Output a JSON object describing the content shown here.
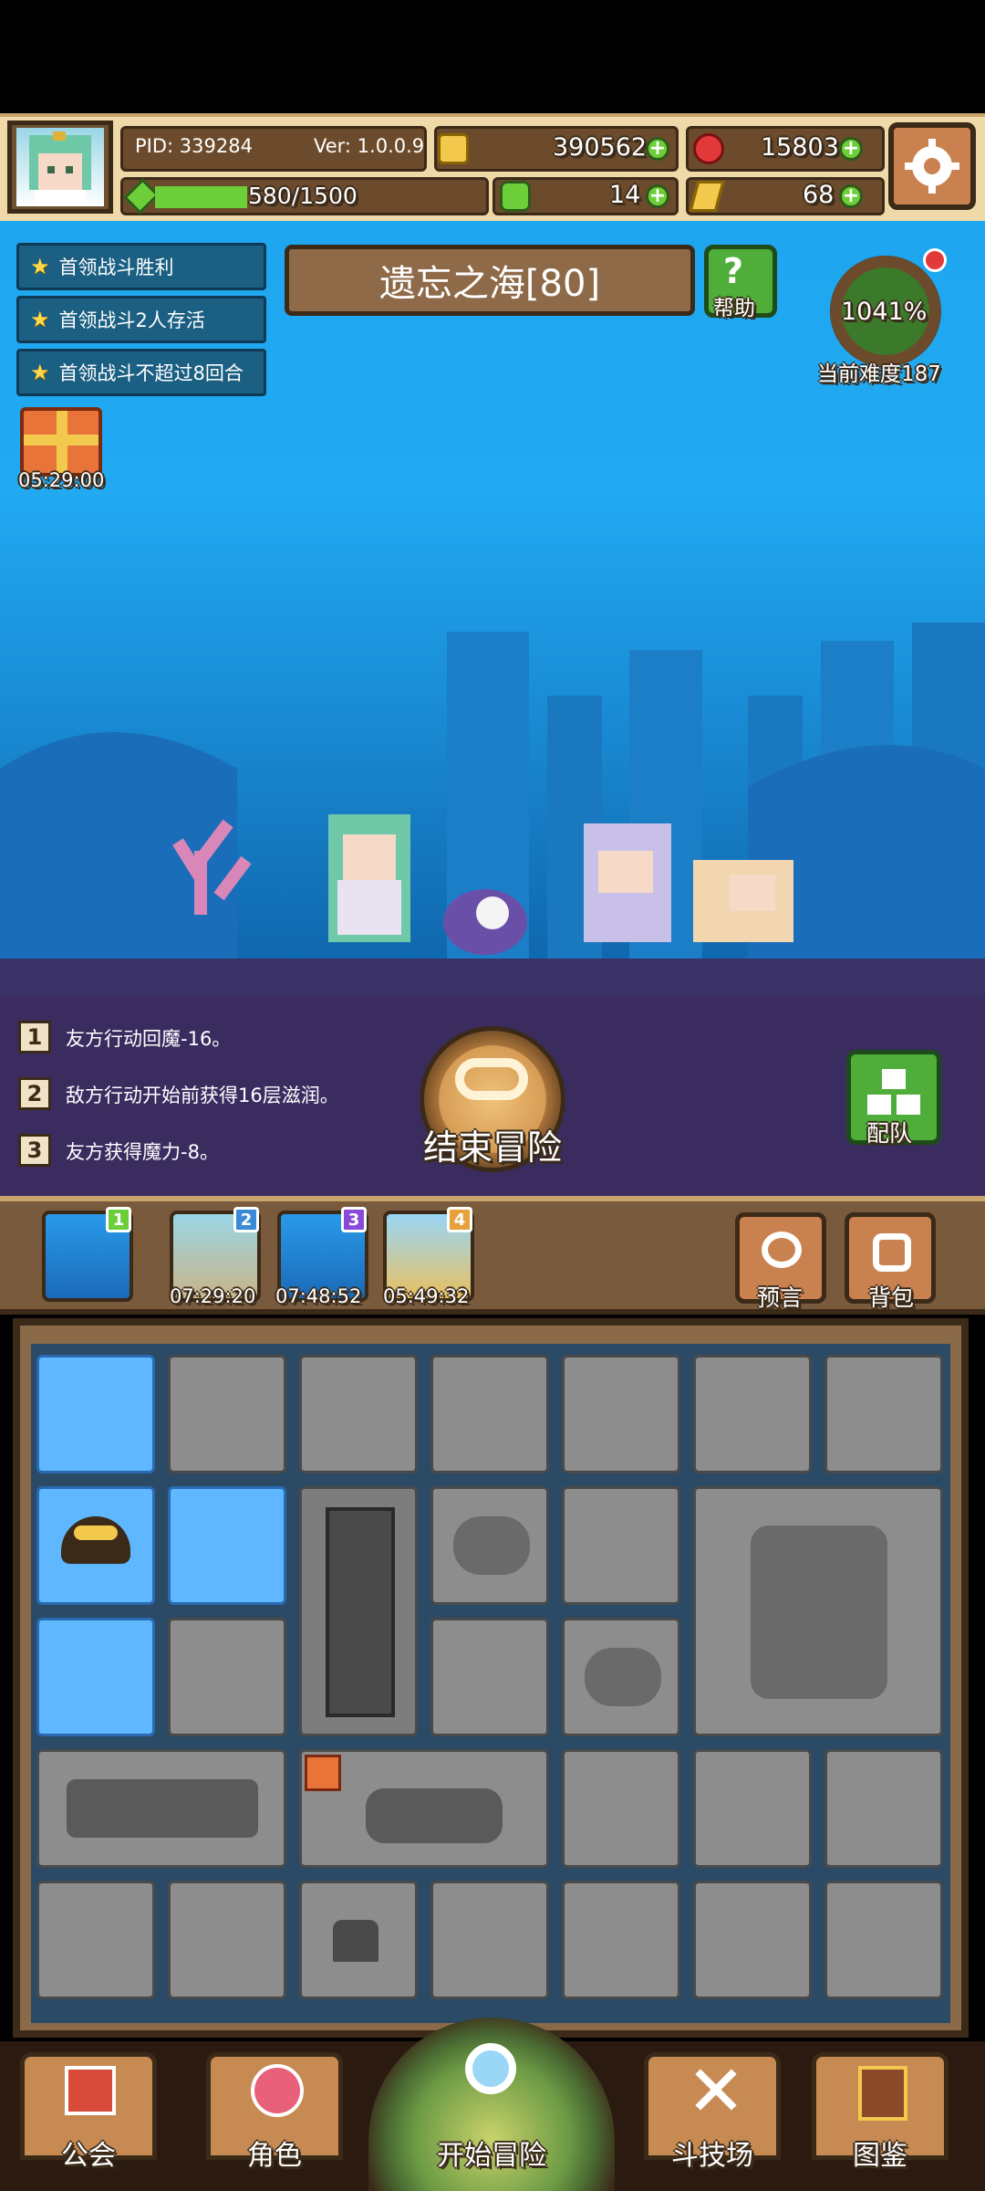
{
  "player": {
    "pid": "PID: 339284",
    "version": "Ver: 1.0.0.9",
    "stamina": "580/1500",
    "stamina_fraction": 0.387
  },
  "currencies": {
    "gold": "390562",
    "gems": "15803",
    "clover": "14",
    "item": "68"
  },
  "quests": [
    "首领战斗胜利",
    "首领战斗2人存活",
    "首领战斗不超过8回合"
  ],
  "gift": {
    "timer": "05:29:00"
  },
  "location": {
    "title": "遗忘之海[80]"
  },
  "help": {
    "label": "帮助"
  },
  "difficulty": {
    "percent": "1041%",
    "label": "当前难度187"
  },
  "battle_log": [
    {
      "num": "1",
      "text": "友方行动回魔-16。"
    },
    {
      "num": "2",
      "text": "敌方行动开始前获得16层滋润。"
    },
    {
      "num": "3",
      "text": "友方获得魔力-8。"
    }
  ],
  "end_button": {
    "label": "结束冒险"
  },
  "team_button": {
    "label": "配队"
  },
  "maps": [
    {
      "badge": "1",
      "timer": ""
    },
    {
      "badge": "2",
      "timer": "07:29:20"
    },
    {
      "badge": "3",
      "timer": "07:48:52"
    },
    {
      "badge": "4",
      "timer": "05:49:32"
    }
  ],
  "side_buttons": {
    "prophecy": "预言",
    "backpack": "背包"
  },
  "nav": {
    "guild": "公会",
    "character": "角色",
    "start": "开始冒险",
    "arena": "斗技场",
    "codex": "图鉴"
  },
  "colors": {
    "sky": "#1ea6f0",
    "wood": "#7a5a3c",
    "accent_green": "#4fae3a",
    "water_tile": "#5fb8ff",
    "stone_tile": "#8d8d8d"
  }
}
